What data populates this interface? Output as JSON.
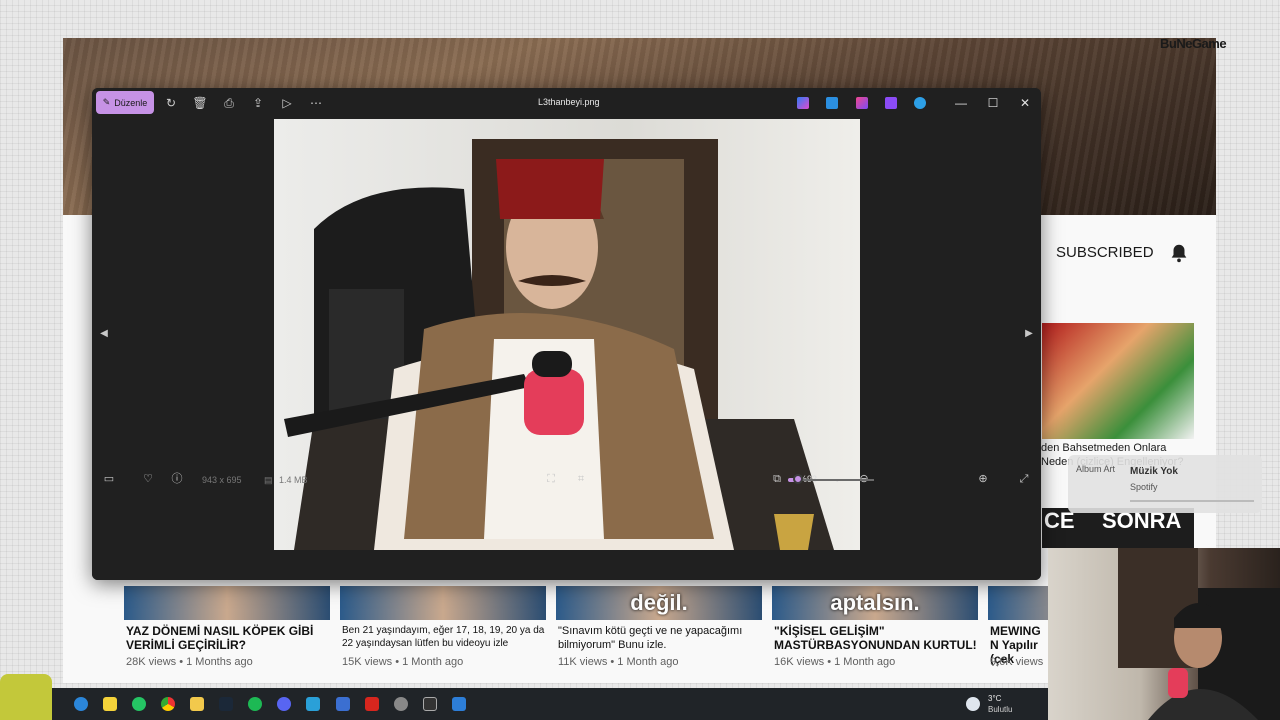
{
  "brand": {
    "prefix": "",
    "name": "BuNeGame"
  },
  "youtube": {
    "subscribed_label": "SUBSCRIBED",
    "side_video": {
      "title": "den Bahsetmeden Onlara Neden (çizlice) Engelleniyor?",
      "thumb_left": "CE",
      "thumb_right": "SONRA"
    },
    "videos": [
      {
        "thumb_text": "",
        "title": "YAZ DÖNEMİ NASIL KÖPEK GİBİ VERİMLİ GEÇİRİLİR?",
        "views": "28K views",
        "age": "1 Months ago"
      },
      {
        "thumb_text": "",
        "title": "Ben 21 yaşındayım, eğer 17, 18, 19, 20 ya da 22 yaşındaysan lütfen bu videoyu izle",
        "views": "15K views",
        "age": "1 Month ago"
      },
      {
        "thumb_text": "değil.",
        "title": "\"Sınavım kötü geçti ve ne yapacağımı bilmiyorum\" Bunu izle.",
        "views": "11K views",
        "age": "1 Month ago"
      },
      {
        "thumb_text": "aptalsın.",
        "title": "\"KİŞİSEL GELİŞİM\" MASTÜRBASYONUNDAN KURTUL!",
        "views": "16K views",
        "age": "1 Month ago"
      },
      {
        "thumb_text": "",
        "title": "MEWING N Yapılır (çek",
        "views": "9,6K views",
        "age": ""
      }
    ]
  },
  "spotify": {
    "art_label": "Album Art",
    "title": "Müzik Yok",
    "app": "Spotify"
  },
  "viewer": {
    "edit_label": "Düzenle",
    "file_name": "L3thanbeyi.png",
    "dimensions": "943 x 695",
    "file_size": "1.4 MB",
    "zoom": "%93",
    "zoom_fraction": 0.12
  },
  "taskbar": {
    "weather_temp": "3°C",
    "weather_desc": "Bulutlu"
  },
  "colors": {
    "accent": "#c692e5",
    "viewer_bg": "#202020",
    "taskbar_bg": "#202428"
  }
}
